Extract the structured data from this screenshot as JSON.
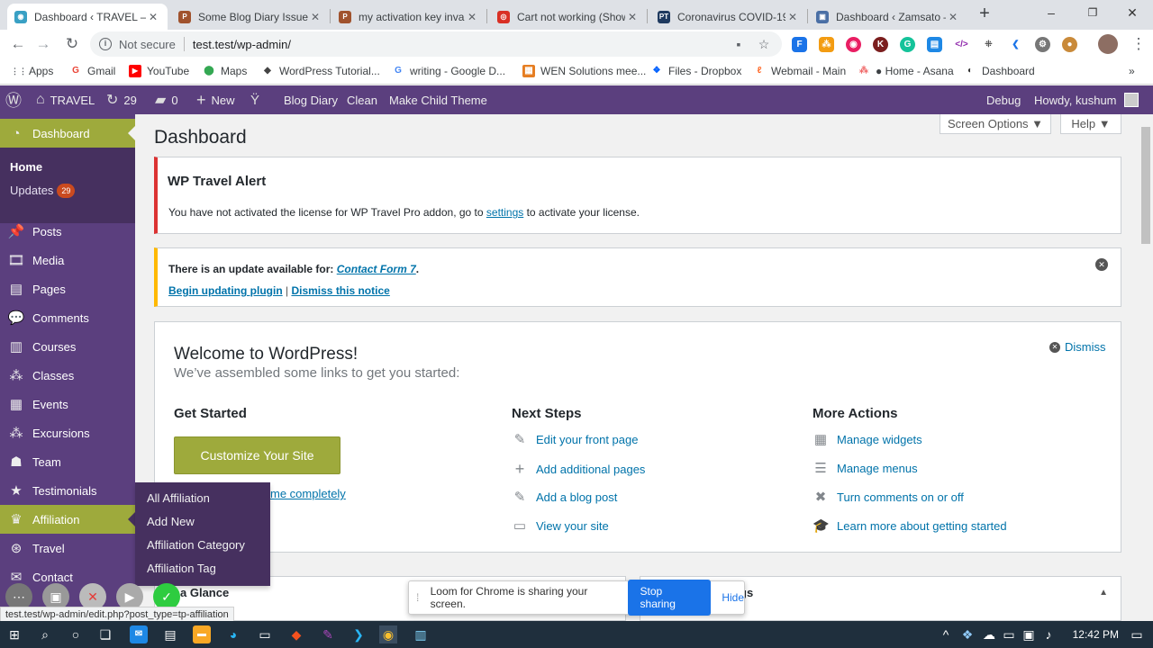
{
  "browser": {
    "tabs": [
      {
        "label": "Dashboard ‹ TRAVEL —",
        "color": "#39a0c4",
        "glyph": "◉"
      },
      {
        "label": "Some Blog Diary Issues",
        "color": "#a0522d",
        "glyph": "P"
      },
      {
        "label": "my activation key invalid",
        "color": "#a0522d",
        "glyph": "P"
      },
      {
        "label": "Cart not working (Show",
        "color": "#d93025",
        "glyph": "◎"
      },
      {
        "label": "Coronavirus COVID-19 (",
        "color": "#1f3a5f",
        "glyph": "PT"
      },
      {
        "label": "Dashboard ‹ Zamsato —",
        "color": "#4a6fa5",
        "glyph": "▣"
      }
    ],
    "close_glyph": "✕",
    "new_tab_glyph": "+",
    "window_controls": [
      "–",
      "❐",
      "✕"
    ],
    "nav": {
      "back": "←",
      "forward": "→",
      "reload": "↻"
    },
    "security_label": "Not secure",
    "url": "test.test/wp-admin/",
    "bookmarks": [
      {
        "label": "Apps",
        "glyph": "⋮⋮",
        "color": "#5f6368"
      },
      {
        "label": "Gmail",
        "glyph": "G",
        "color": "#ea4335"
      },
      {
        "label": "YouTube",
        "glyph": "▶",
        "color": "#ff0000"
      },
      {
        "label": "Maps",
        "glyph": "⬤",
        "color": "#34a853"
      },
      {
        "label": "WordPress Tutorial...",
        "glyph": "◆",
        "color": "#444"
      },
      {
        "label": "writing - Google D...",
        "glyph": "G",
        "color": "#4285f4"
      },
      {
        "label": "WEN Solutions mee...",
        "glyph": "▦",
        "color": "#e67e22"
      },
      {
        "label": "Files - Dropbox",
        "glyph": "❖",
        "color": "#0061fe"
      },
      {
        "label": "Webmail - Main",
        "glyph": "ℓ",
        "color": "#ff6c2c"
      },
      {
        "label": "● Home - Asana",
        "glyph": "⁂",
        "color": "#f06a6a"
      },
      {
        "label": "Dashboard",
        "glyph": "◐",
        "color": "#333"
      }
    ],
    "bookmarks_more": "»",
    "status_url": "test.test/wp-admin/edit.php?post_type=tp-affiliation"
  },
  "adminbar": {
    "site_name": "TRAVEL",
    "updates_count": "29",
    "comments_count": "0",
    "new_label": "New",
    "items": [
      "Blog Diary",
      "Clean",
      "Make Child Theme"
    ],
    "debug": "Debug",
    "howdy": "Howdy, kushum"
  },
  "sidebar": {
    "dashboard": "Dashboard",
    "home": "Home",
    "updates": "Updates",
    "updates_badge": "29",
    "items": [
      {
        "label": "Posts",
        "icon": "📌",
        "name": "posts"
      },
      {
        "label": "Media",
        "icon": "🎞",
        "name": "media"
      },
      {
        "label": "Pages",
        "icon": "▤",
        "name": "pages"
      },
      {
        "label": "Comments",
        "icon": "💬",
        "name": "comments"
      },
      {
        "label": "Courses",
        "icon": "▥",
        "name": "courses"
      },
      {
        "label": "Classes",
        "icon": "⁂",
        "name": "classes"
      },
      {
        "label": "Events",
        "icon": "▦",
        "name": "events"
      },
      {
        "label": "Excursions",
        "icon": "⁂",
        "name": "excursions"
      },
      {
        "label": "Team",
        "icon": "☗",
        "name": "team"
      },
      {
        "label": "Testimonials",
        "icon": "★",
        "name": "testimonials"
      },
      {
        "label": "Affiliation",
        "icon": "♛",
        "name": "affiliation"
      },
      {
        "label": "Travel",
        "icon": "⊛",
        "name": "travel"
      },
      {
        "label": "Contact",
        "icon": "✉",
        "name": "contact"
      }
    ],
    "flyout": [
      "All Affiliation",
      "Add New",
      "Affiliation Category",
      "Affiliation Tag"
    ]
  },
  "header": {
    "title": "Dashboard",
    "screen_options": "Screen Options ▼",
    "help": "Help ▼"
  },
  "alert": {
    "title": "WP Travel Alert",
    "text_before": "You have not activated the license for WP Travel Pro addon, go to ",
    "link": "settings",
    "text_after": " to activate your license."
  },
  "update_notice": {
    "text": "There is an update available for: ",
    "plugin": "Contact Form 7",
    "period": ".",
    "begin": "Begin updating plugin",
    "sep": " | ",
    "dismiss": "Dismiss this notice"
  },
  "welcome": {
    "title": "Welcome to WordPress!",
    "subtitle": "We’ve assembled some links to get you started:",
    "dismiss": "Dismiss",
    "get_started": "Get Started",
    "customize_button": "Customize Your Site",
    "change_theme_partial": "me completely",
    "next_steps": "Next Steps",
    "next_items": [
      {
        "label": "Edit your front page",
        "icon": "✎"
      },
      {
        "label": "Add additional pages",
        "icon": "+"
      },
      {
        "label": "Add a blog post",
        "icon": "✎"
      },
      {
        "label": "View your site",
        "icon": "▭"
      }
    ],
    "more_actions": "More Actions",
    "more_items": [
      {
        "label": "Manage widgets",
        "icon": "▦"
      },
      {
        "label": "Manage menus",
        "icon": "☰"
      },
      {
        "label": "Turn comments on or off",
        "icon": "✖"
      },
      {
        "label": "Learn more about getting started",
        "icon": "🎓"
      }
    ]
  },
  "boxes": {
    "glance_partial": "a Glance",
    "right_partial": "gs"
  },
  "loom": {
    "message": "Loom for Chrome is sharing your screen.",
    "stop": "Stop sharing",
    "hide": "Hide"
  },
  "taskbar": {
    "time": "12:42 PM"
  },
  "colors": {
    "admin_purple": "#5b3f7e",
    "accent_green": "#9eaa3c",
    "link_blue": "#0073aa"
  }
}
